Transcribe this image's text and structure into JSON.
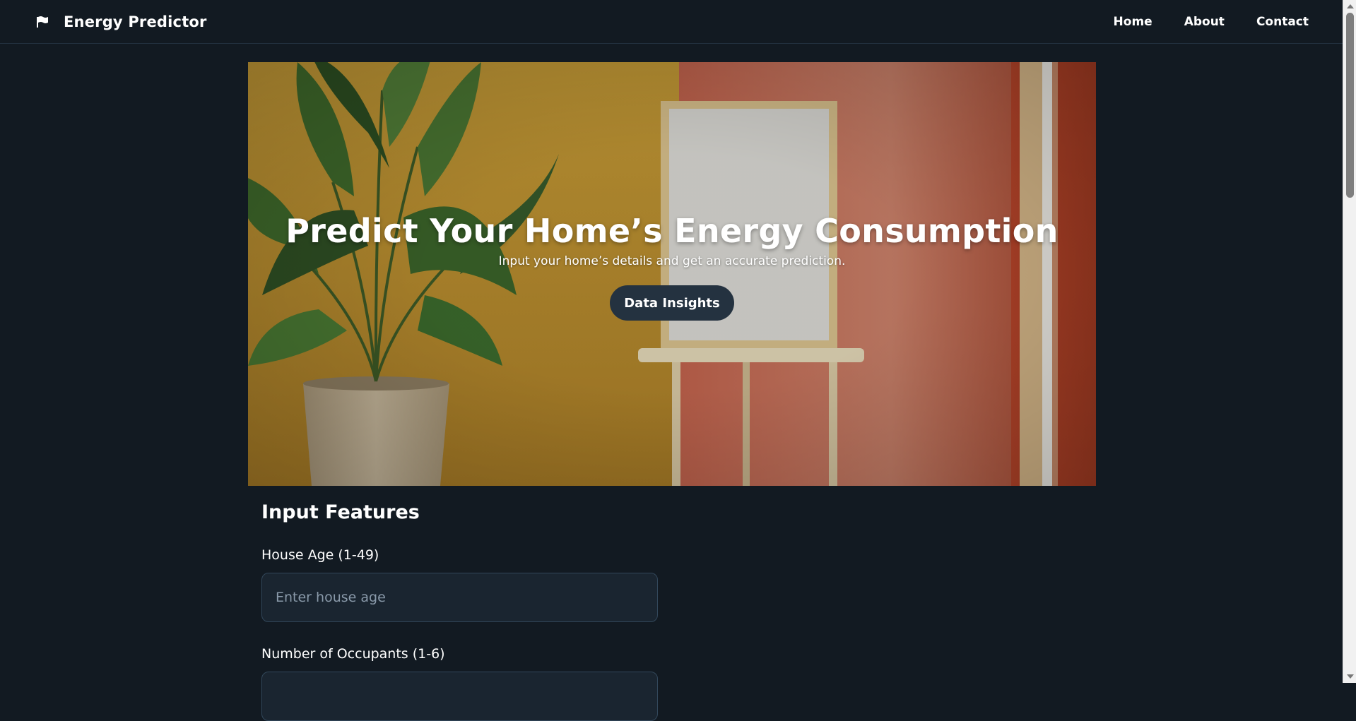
{
  "header": {
    "brand_icon": "flag-icon",
    "brand_name": "Energy Predictor",
    "nav": [
      {
        "label": "Home"
      },
      {
        "label": "About"
      },
      {
        "label": "Contact"
      }
    ]
  },
  "hero": {
    "title": "Predict Your Home’s Energy Consumption",
    "subtitle": "Input your home’s details and get an accurate prediction.",
    "cta_label": "Data Insights"
  },
  "form": {
    "title": "Input Features",
    "fields": [
      {
        "label": "House Age (1-49)",
        "placeholder": "Enter house age",
        "value": ""
      },
      {
        "label": "Number of Occupants (1-6)",
        "placeholder": "",
        "value": ""
      }
    ]
  },
  "colors": {
    "background": "#121a22",
    "accent_button": "#243240",
    "input_background": "#1a2530",
    "input_border": "#32475a"
  }
}
